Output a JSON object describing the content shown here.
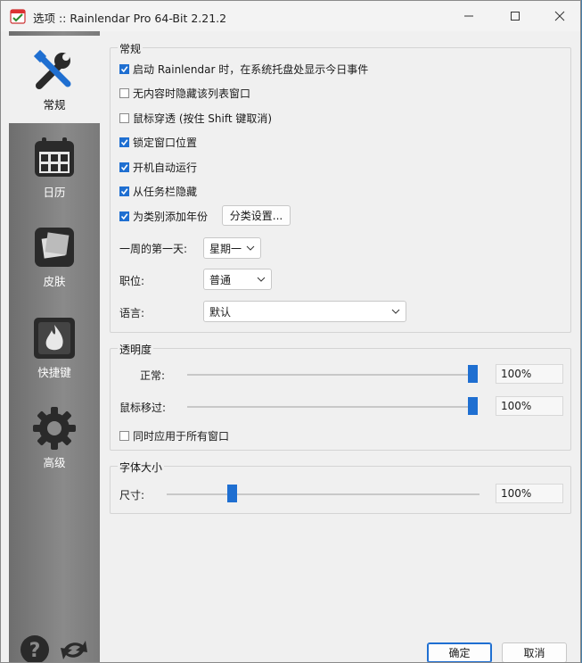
{
  "window": {
    "title": "选项 :: Rainlendar Pro 64-Bit 2.21.2"
  },
  "sidebar": {
    "items": [
      {
        "label": "常规",
        "icon": "tools-icon",
        "selected": true
      },
      {
        "label": "日历",
        "icon": "calendar-icon",
        "selected": false
      },
      {
        "label": "皮肤",
        "icon": "skin-icon",
        "selected": false
      },
      {
        "label": "快捷键",
        "icon": "hotkey-icon",
        "selected": false
      },
      {
        "label": "高级",
        "icon": "gear-icon",
        "selected": false
      }
    ],
    "bottom_icons": [
      "help-icon",
      "refresh-icon"
    ]
  },
  "general": {
    "title": "常规",
    "checks": [
      {
        "label": "启动 Rainlendar 时，在系统托盘处显示今日事件",
        "checked": true
      },
      {
        "label": "无内容时隐藏该列表窗口",
        "checked": false
      },
      {
        "label": "鼠标穿透 (按住 Shift 键取消)",
        "checked": false
      },
      {
        "label": "锁定窗口位置",
        "checked": true
      },
      {
        "label": "开机自动运行",
        "checked": true
      },
      {
        "label": "从任务栏隐藏",
        "checked": true
      },
      {
        "label": "为类别添加年份",
        "checked": true
      }
    ],
    "category_button": "分类设置...",
    "first_day_label": "一周的第一天:",
    "first_day_value": "星期一",
    "position_label": "职位:",
    "position_value": "普通",
    "language_label": "语言:",
    "language_value": "默认"
  },
  "transparency": {
    "title": "透明度",
    "normal_label": "正常:",
    "normal_value": "100%",
    "normal_level": 1.0,
    "hover_label": "鼠标移过:",
    "hover_value": "100%",
    "hover_level": 1.0,
    "apply_all_label": "同时应用于所有窗口",
    "apply_all_checked": false
  },
  "font": {
    "title": "字体大小",
    "size_label": "尺寸:",
    "size_value": "100%",
    "size_level": 0.2
  },
  "footer": {
    "ok": "确定",
    "cancel": "取消"
  },
  "colors": {
    "accent": "#1f6fd1",
    "sidebar": "#7a7a7a"
  }
}
